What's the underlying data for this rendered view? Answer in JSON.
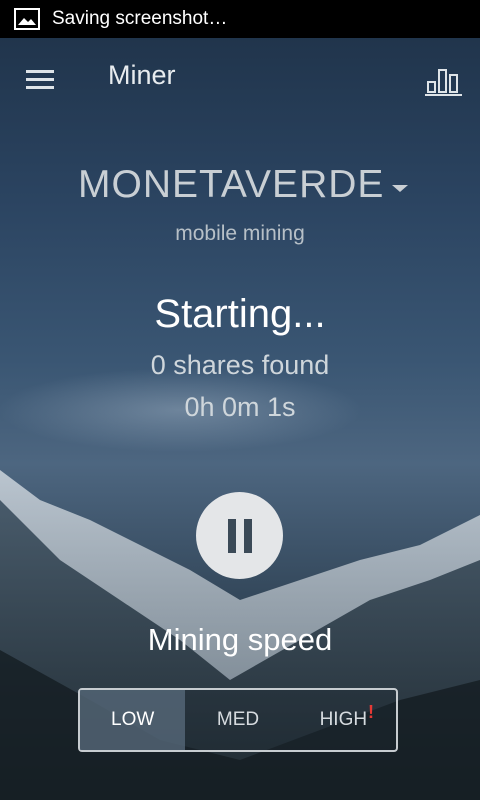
{
  "status_bar": {
    "icon": "image-icon",
    "text": "Saving screenshot…"
  },
  "app_bar": {
    "menu_icon": "hamburger-menu-icon",
    "title": "Miner",
    "stats_icon": "bar-chart-icon"
  },
  "coin": {
    "name": "MONETAVERDE",
    "subtitle": "mobile mining"
  },
  "mining": {
    "status": "Starting...",
    "shares": "0 shares found",
    "elapsed": "0h 0m 1s",
    "pause_icon": "pause-icon"
  },
  "speed": {
    "label": "Mining speed",
    "options": [
      "LOW",
      "MED",
      "HIGH"
    ],
    "selected": "LOW",
    "high_warning": "!"
  },
  "colors": {
    "accent_warning": "#e53935",
    "pause_button_bg": "#e4e6e8"
  }
}
